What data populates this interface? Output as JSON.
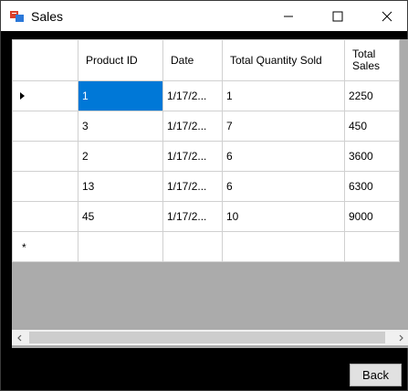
{
  "window": {
    "title": "Sales",
    "icon": "windows-form-icon",
    "controls": {
      "minimize": "minimize-icon",
      "maximize": "maximize-icon",
      "close": "close-icon"
    }
  },
  "grid": {
    "columns": [
      "Product ID",
      "Date",
      "Total Quantity Sold",
      "Total Sales"
    ],
    "rows": [
      {
        "product_id": "1",
        "date": "1/17/2...",
        "qty": "1",
        "sales": "2250"
      },
      {
        "product_id": "3",
        "date": "1/17/2...",
        "qty": "7",
        "sales": "450"
      },
      {
        "product_id": "2",
        "date": "1/17/2...",
        "qty": "6",
        "sales": "3600"
      },
      {
        "product_id": "13",
        "date": "1/17/2...",
        "qty": "6",
        "sales": "6300"
      },
      {
        "product_id": "45",
        "date": "1/17/2...",
        "qty": "10",
        "sales": "9000"
      }
    ],
    "new_row_marker": "*",
    "selected_cell": "row 1, Product ID"
  },
  "buttons": {
    "back": "Back"
  },
  "colors": {
    "selection": "#0078d7",
    "grid_background": "#ababab",
    "window_background": "#000000"
  }
}
